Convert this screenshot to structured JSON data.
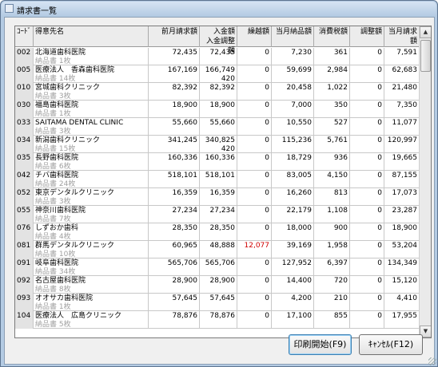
{
  "window": {
    "title": "請求書一覧"
  },
  "columns": [
    "ｺｰﾄﾞ",
    "得意先名",
    "前月請求額",
    "入金額\n入金調整額",
    "繰越額",
    "当月納品額",
    "消費税額",
    "調整額",
    "当月請求額"
  ],
  "rows": [
    {
      "code": "002",
      "name": "北海道歯科医院",
      "sub": "納品書 1枚",
      "prev": "72,435",
      "pay": "72,435",
      "adj": "",
      "carry": "0",
      "sales": "7,230",
      "tax": "361",
      "cadj": "0",
      "total": "7,591",
      "red": false
    },
    {
      "code": "005",
      "name": "医療法人　香森歯科医院",
      "sub": "納品書 14枚",
      "prev": "167,169",
      "pay": "166,749",
      "adj": "420",
      "carry": "0",
      "sales": "59,699",
      "tax": "2,984",
      "cadj": "0",
      "total": "62,683",
      "red": false
    },
    {
      "code": "010",
      "name": "宮城歯科クリニック",
      "sub": "納品書 3枚",
      "prev": "82,392",
      "pay": "82,392",
      "adj": "",
      "carry": "0",
      "sales": "20,458",
      "tax": "1,022",
      "cadj": "0",
      "total": "21,480",
      "red": false
    },
    {
      "code": "030",
      "name": "福島歯科医院",
      "sub": "納品書 1枚",
      "prev": "18,900",
      "pay": "18,900",
      "adj": "",
      "carry": "0",
      "sales": "7,000",
      "tax": "350",
      "cadj": "0",
      "total": "7,350",
      "red": false
    },
    {
      "code": "033",
      "name": "SAITAMA DENTAL CLINIC",
      "sub": "納品書 3枚",
      "prev": "55,660",
      "pay": "55,660",
      "adj": "",
      "carry": "0",
      "sales": "10,550",
      "tax": "527",
      "cadj": "0",
      "total": "11,077",
      "red": false
    },
    {
      "code": "034",
      "name": "新潟歯科クリニック",
      "sub": "納品書 15枚",
      "prev": "341,245",
      "pay": "340,825",
      "adj": "420",
      "carry": "0",
      "sales": "115,236",
      "tax": "5,761",
      "cadj": "0",
      "total": "120,997",
      "red": false
    },
    {
      "code": "035",
      "name": "長野歯科医院",
      "sub": "納品書 6枚",
      "prev": "160,336",
      "pay": "160,336",
      "adj": "",
      "carry": "0",
      "sales": "18,729",
      "tax": "936",
      "cadj": "0",
      "total": "19,665",
      "red": false
    },
    {
      "code": "042",
      "name": "チバ歯科医院",
      "sub": "納品書 24枚",
      "prev": "518,101",
      "pay": "518,101",
      "adj": "",
      "carry": "0",
      "sales": "83,005",
      "tax": "4,150",
      "cadj": "0",
      "total": "87,155",
      "red": false
    },
    {
      "code": "052",
      "name": "東京デンタルクリニック",
      "sub": "納品書 3枚",
      "prev": "16,359",
      "pay": "16,359",
      "adj": "",
      "carry": "0",
      "sales": "16,260",
      "tax": "813",
      "cadj": "0",
      "total": "17,073",
      "red": false
    },
    {
      "code": "055",
      "name": "神奈川歯科医院",
      "sub": "納品書 7枚",
      "prev": "27,234",
      "pay": "27,234",
      "adj": "",
      "carry": "0",
      "sales": "22,179",
      "tax": "1,108",
      "cadj": "0",
      "total": "23,287",
      "red": false
    },
    {
      "code": "076",
      "name": "しずおか歯科",
      "sub": "納品書 4枚",
      "prev": "28,350",
      "pay": "28,350",
      "adj": "",
      "carry": "0",
      "sales": "18,000",
      "tax": "900",
      "cadj": "0",
      "total": "18,900",
      "red": false
    },
    {
      "code": "081",
      "name": "群馬デンタルクリニック",
      "sub": "納品書 10枚",
      "prev": "60,965",
      "pay": "48,888",
      "adj": "",
      "carry": "12,077",
      "sales": "39,169",
      "tax": "1,958",
      "cadj": "0",
      "total": "53,204",
      "red": true
    },
    {
      "code": "091",
      "name": "岐阜歯科医院",
      "sub": "納品書 34枚",
      "prev": "565,706",
      "pay": "565,706",
      "adj": "",
      "carry": "0",
      "sales": "127,952",
      "tax": "6,397",
      "cadj": "0",
      "total": "134,349",
      "red": false
    },
    {
      "code": "092",
      "name": "名古屋歯科医院",
      "sub": "納品書 8枚",
      "prev": "28,900",
      "pay": "28,900",
      "adj": "",
      "carry": "0",
      "sales": "14,400",
      "tax": "720",
      "cadj": "0",
      "total": "15,120",
      "red": false
    },
    {
      "code": "093",
      "name": "オオサカ歯科医院",
      "sub": "納品書 1枚",
      "prev": "57,645",
      "pay": "57,645",
      "adj": "",
      "carry": "0",
      "sales": "4,200",
      "tax": "210",
      "cadj": "0",
      "total": "4,410",
      "red": false
    },
    {
      "code": "104",
      "name": "医療法人　広島クリニック",
      "sub": "納品書 5枚",
      "prev": "78,876",
      "pay": "78,876",
      "adj": "",
      "carry": "0",
      "sales": "17,100",
      "tax": "855",
      "cadj": "0",
      "total": "17,955",
      "red": false
    }
  ],
  "buttons": {
    "print": "印刷開始(F9)",
    "cancel": "ｷｬﾝｾﾙ(F12)"
  },
  "icons": {
    "window_icon": "document-icon",
    "scroll_up": "arrow-up-icon",
    "scroll_down": "arrow-down-icon"
  },
  "colors": {
    "carry_alert": "#d00000",
    "code_bg": "#e3e3e3"
  }
}
